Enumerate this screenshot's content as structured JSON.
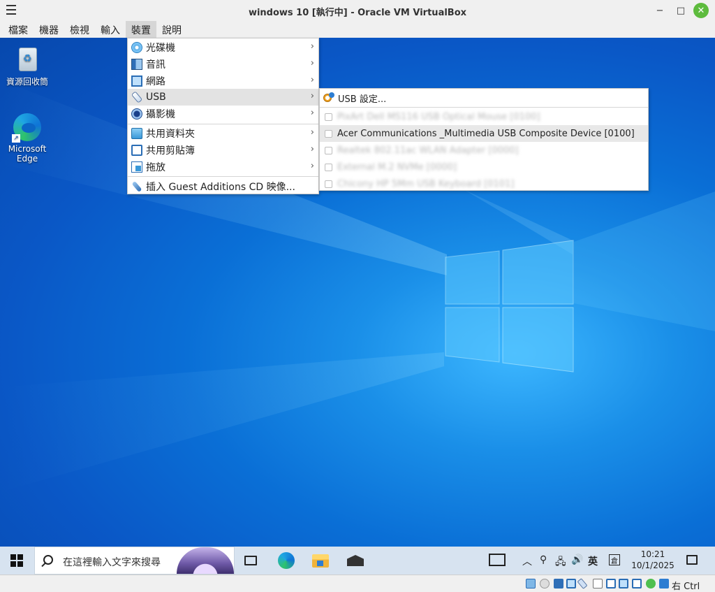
{
  "window": {
    "title": "windows 10 [執行中] - Oracle VM VirtualBox",
    "min_glyph": "−",
    "max_glyph": "□",
    "close_glyph": "✕"
  },
  "menubar": {
    "items": [
      "檔案",
      "機器",
      "檢視",
      "輸入",
      "裝置",
      "說明"
    ],
    "active_index": 4
  },
  "devices_menu": {
    "items": [
      {
        "label": "光碟機",
        "icon": "optical-disc-icon",
        "has_submenu": true
      },
      {
        "label": "音訊",
        "icon": "audio-icon",
        "has_submenu": true
      },
      {
        "label": "網路",
        "icon": "network-icon",
        "has_submenu": true
      },
      {
        "label": "USB",
        "icon": "usb-icon",
        "has_submenu": true,
        "highlighted": true
      },
      {
        "label": "攝影機",
        "icon": "webcam-icon",
        "has_submenu": true
      },
      {
        "label": "共用資料夾",
        "icon": "shared-folder-icon",
        "has_submenu": true
      },
      {
        "label": "共用剪貼簿",
        "icon": "clipboard-icon",
        "has_submenu": true
      },
      {
        "label": "拖放",
        "icon": "drag-drop-icon",
        "has_submenu": true
      },
      {
        "label": "插入 Guest Additions CD 映像...",
        "icon": "guest-additions-cd-icon",
        "has_submenu": false
      }
    ]
  },
  "usb_submenu": {
    "settings_label": "USB 設定...",
    "devices": [
      {
        "label": "PixArt Dell MS116 USB Optical Mouse [0100]",
        "blurred": true,
        "checked": false
      },
      {
        "label": "Acer Communications _Multimedia USB Composite Device [0100]",
        "blurred": false,
        "checked": false,
        "highlighted": true
      },
      {
        "label": "Realtek 802.11ac WLAN Adapter [0000]",
        "blurred": true,
        "checked": false
      },
      {
        "label": "External M.2 NVMe [0000]",
        "blurred": true,
        "checked": false
      },
      {
        "label": "Chicony HP 5Mm USB Keyboard [0101]",
        "blurred": true,
        "checked": false
      }
    ]
  },
  "desktop": {
    "icons": [
      {
        "label": "資源回收筒"
      },
      {
        "label": "Microsoft Edge"
      }
    ]
  },
  "taskbar": {
    "search_placeholder": "在這裡輸入文字來搜尋",
    "ime_label": "英",
    "time": "10:21",
    "date": "10/1/2025"
  },
  "statusbar": {
    "host_key": "右 Ctrl"
  }
}
